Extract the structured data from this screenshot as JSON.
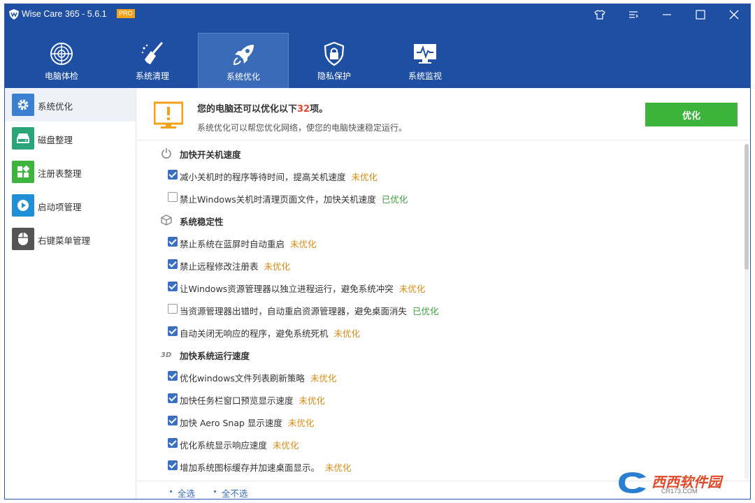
{
  "app": {
    "title": "Wise Care 365 - 5.6.1",
    "badge": "PRO",
    "brand_color": "#1e4fa3"
  },
  "titlebar_buttons": [
    {
      "name": "skin-icon"
    },
    {
      "name": "menu-icon"
    },
    {
      "name": "minimize-icon"
    },
    {
      "name": "maximize-icon"
    },
    {
      "name": "close-icon"
    }
  ],
  "nav": {
    "items": [
      {
        "label": "电脑体检",
        "icon": "radar-icon",
        "active": false
      },
      {
        "label": "系统清理",
        "icon": "broom-icon",
        "active": false
      },
      {
        "label": "系统优化",
        "icon": "rocket-icon",
        "active": true
      },
      {
        "label": "隐私保护",
        "icon": "lock-shield-icon",
        "active": false
      },
      {
        "label": "系统监视",
        "icon": "monitor-icon",
        "active": false
      }
    ]
  },
  "sidebar": {
    "items": [
      {
        "label": "系统优化",
        "icon": "gear-icon",
        "color": "#3b7fd0",
        "active": true
      },
      {
        "label": "磁盘整理",
        "icon": "disk-icon",
        "color": "#2aa57a",
        "active": false
      },
      {
        "label": "注册表整理",
        "icon": "registry-icon",
        "color": "#3db53d",
        "active": false
      },
      {
        "label": "启动项管理",
        "icon": "play-icon",
        "color": "#1f8fd6",
        "active": false
      },
      {
        "label": "右键菜单管理",
        "icon": "mouse-icon",
        "color": "#555555",
        "active": false
      }
    ]
  },
  "summary": {
    "title_prefix": "您的电脑还可以优化以下",
    "count": "32",
    "title_suffix": "项。",
    "subtitle": "系统优化可以帮您优化网络，使您的电脑快速稳定运行。",
    "button_label": "优化"
  },
  "status_labels": {
    "pending": "未优化",
    "done": "已优化"
  },
  "categories": [
    {
      "label": "加快开关机速度",
      "icon": "power-icon",
      "items": [
        {
          "text": "减小关机时的程序等待时间，提高关机速度",
          "checked": true,
          "status": "未优化"
        },
        {
          "text": "禁止Windows关机时清理页面文件，加快关机速度",
          "checked": false,
          "status": "已优化"
        }
      ]
    },
    {
      "label": "系统稳定性",
      "icon": "cube-icon",
      "items": [
        {
          "text": "禁止系统在蓝屏时自动重启",
          "checked": true,
          "status": "未优化"
        },
        {
          "text": "禁止远程修改注册表",
          "checked": true,
          "status": "未优化"
        },
        {
          "text": "让Windows资源管理器以独立进程运行，避免系统冲突",
          "checked": true,
          "status": "未优化"
        },
        {
          "text": "当资源管理器出错时，自动重启资源管理器，避免桌面消失",
          "checked": false,
          "status": "已优化"
        },
        {
          "text": "自动关闭无响应的程序，避免系统死机",
          "checked": true,
          "status": "未优化"
        }
      ]
    },
    {
      "label": "加快系统运行速度",
      "icon": "3d-icon",
      "items": [
        {
          "text": "优化windows文件列表刷新策略",
          "checked": true,
          "status": "未优化"
        },
        {
          "text": "加快任务栏窗口预览显示速度",
          "checked": true,
          "status": "未优化"
        },
        {
          "text": "加快 Aero Snap 显示速度",
          "checked": true,
          "status": "未优化"
        },
        {
          "text": "优化系统显示响应速度",
          "checked": true,
          "status": "未优化"
        },
        {
          "text": "增加系统图标缓存并加速桌面显示。",
          "checked": true,
          "status": "未优化"
        }
      ]
    }
  ],
  "footer": {
    "select_all": "全选",
    "select_none": "全不选"
  },
  "watermark": {
    "text": "西西软件园",
    "url": "CR173.COM"
  }
}
